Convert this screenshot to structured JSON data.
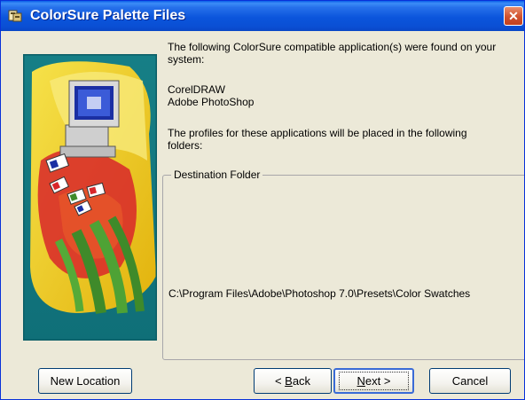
{
  "window": {
    "title": "ColorSure Palette Files"
  },
  "intro": {
    "line1": "The following ColorSure compatible application(s) were found on your",
    "line2": "system:"
  },
  "applications": [
    "CorelDRAW",
    "Adobe PhotoShop"
  ],
  "profiles_note": {
    "line1": "The profiles for these applications will be placed in the following",
    "line2": "folders:"
  },
  "destination": {
    "legend": "Destination Folder",
    "path": "C:\\Program Files\\Adobe\\Photoshop 7.0\\Presets\\Color Swatches"
  },
  "buttons": {
    "new_location": "New Location",
    "back_prefix": "< ",
    "back_accel": "B",
    "back_rest": "ack",
    "next_accel": "N",
    "next_rest": "ext >",
    "cancel": "Cancel"
  },
  "colors": {
    "title_bar": "#0a55dc",
    "dialog_bg": "#ece9d8",
    "close_button": "#d0512e",
    "art_teal": "#1a8f95",
    "art_yellow": "#f2d41a",
    "art_red": "#d8262a",
    "art_green": "#3f8a2a"
  },
  "icons": {
    "title": "installer-app-icon",
    "close": "close-x-icon",
    "art": "computer-with-color-swatches-artwork"
  }
}
